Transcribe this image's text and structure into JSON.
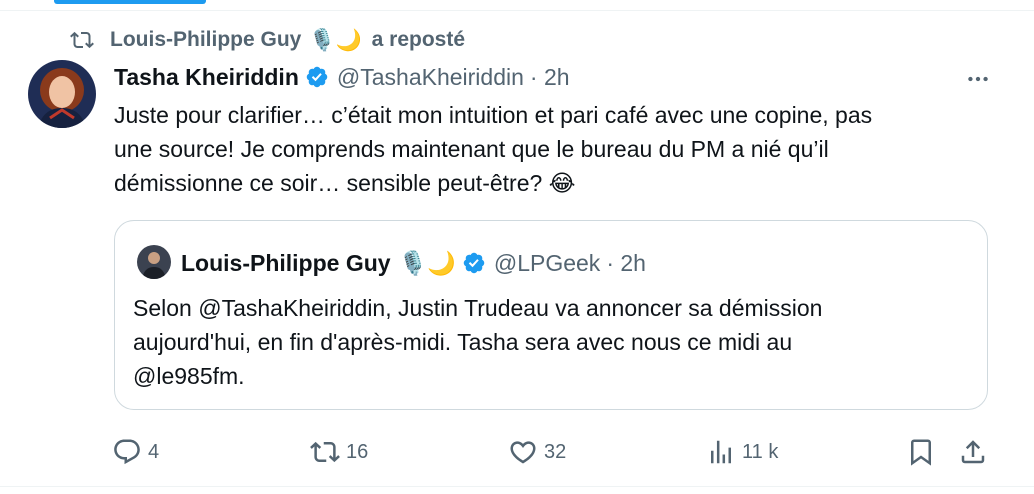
{
  "repost": {
    "reposter_name": "Louis-Philippe Guy",
    "reposter_emojis": "🎙️🌙",
    "suffix": "a reposté"
  },
  "tweet": {
    "author_name": "Tasha Kheiriddin",
    "author_handle": "@TashaKheiriddin",
    "time": "· 2h",
    "text_lines": [
      "Juste pour clarifier… c’était mon intuition et pari café avec une copine, pas",
      "une source! Je comprends maintenant que le bureau du PM a nié qu’il",
      "démissionne ce soir… sensible peut-être? 😂"
    ]
  },
  "quote": {
    "author_name": "Louis-Philippe Guy",
    "author_emojis": "🎙️🌙",
    "author_handle": "@LPGeek",
    "time": "· 2h",
    "text_lines": [
      "Selon @TashaKheiriddin, Justin Trudeau va annoncer sa démission",
      "aujourd'hui, en fin d'après-midi. Tasha sera avec nous ce midi au",
      "@le985fm."
    ]
  },
  "actions": {
    "replies": "4",
    "reposts": "16",
    "likes": "32",
    "views": "11 k"
  },
  "icons": [
    "repost-icon",
    "verified-icon",
    "more-icon",
    "reply-icon",
    "like-icon",
    "views-icon",
    "bookmark-icon",
    "share-icon"
  ],
  "colors": {
    "accent": "#1d9bf0",
    "muted": "#536471",
    "text": "#0f1419",
    "border": "#cfd9de"
  }
}
